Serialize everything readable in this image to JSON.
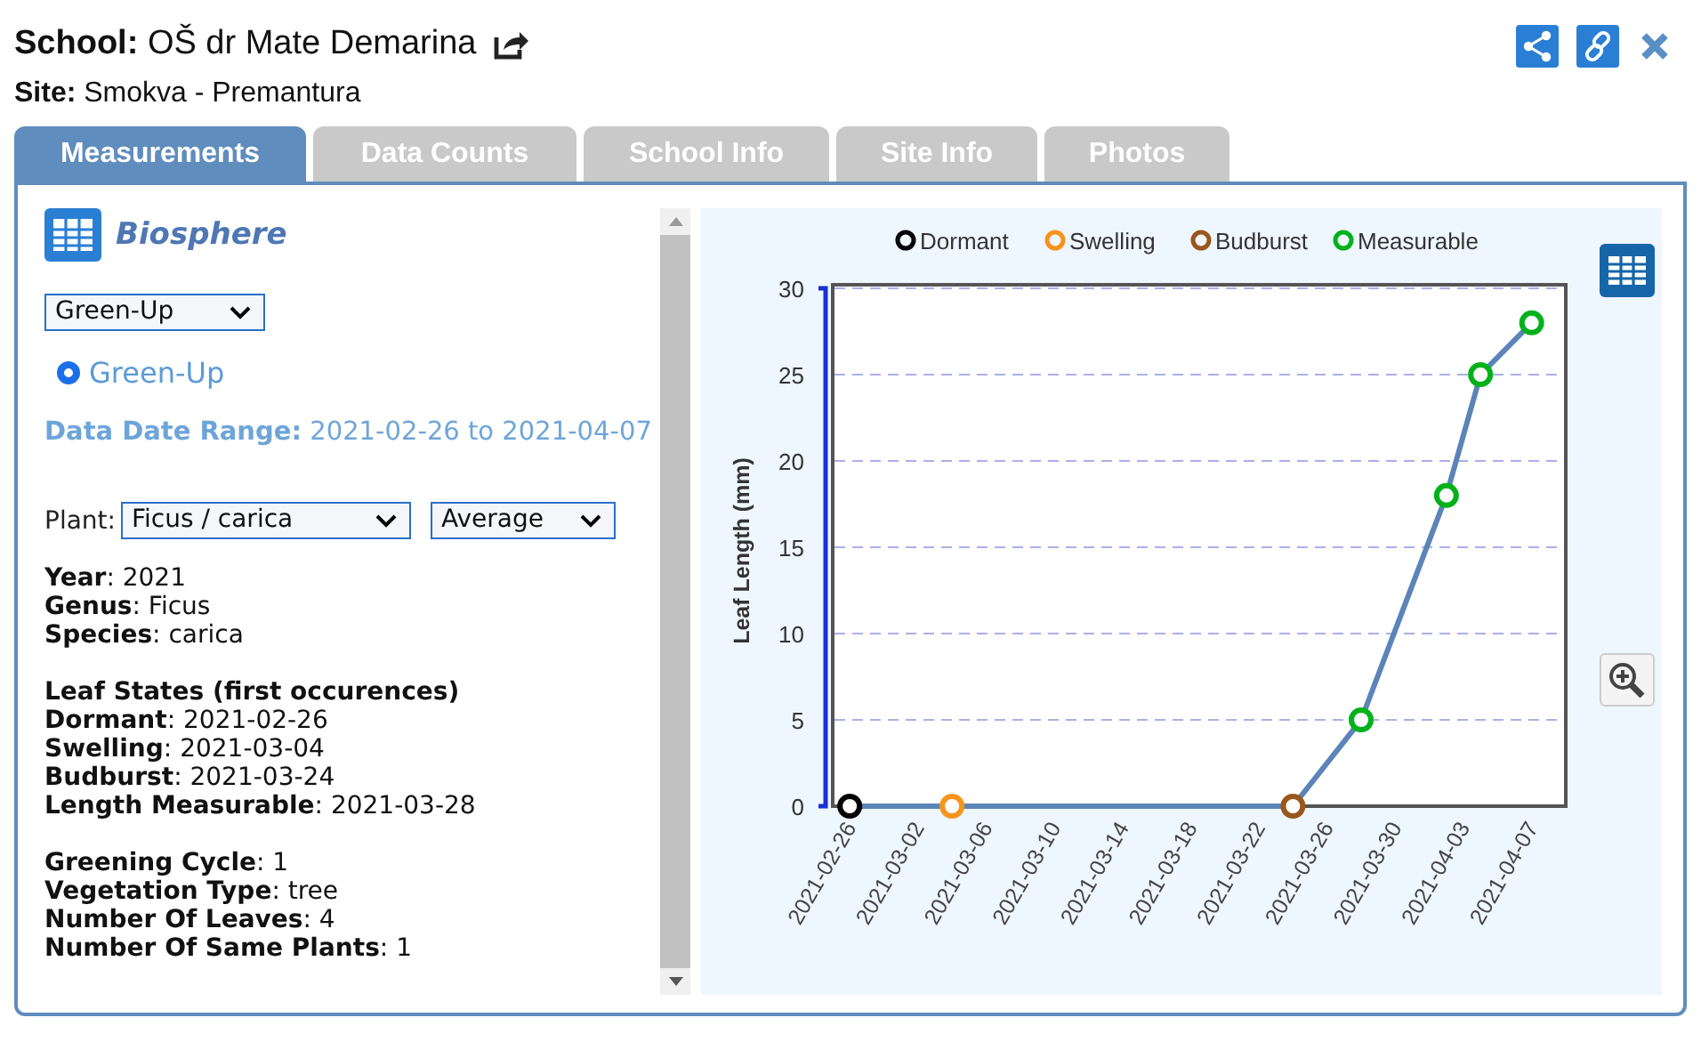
{
  "header": {
    "school_label": "School:",
    "school": "OŠ dr Mate Demarina",
    "site_label": "Site:",
    "site": "Smokva - Premantura"
  },
  "tabs": [
    {
      "label": "Measurements",
      "selected": true
    },
    {
      "label": "Data Counts",
      "selected": false
    },
    {
      "label": "School Info",
      "selected": false
    },
    {
      "label": "Site Info",
      "selected": false
    },
    {
      "label": "Photos",
      "selected": false
    }
  ],
  "protocol": {
    "title": "Biosphere",
    "dropdown": "Green-Up",
    "radio": {
      "label": "Green-Up",
      "selected": true
    },
    "date_range_label": "Data Date Range:",
    "date_range": "2021-02-26 to 2021-04-07"
  },
  "plant": {
    "label": "Plant:",
    "species_dropdown": "Ficus / carica",
    "mode_dropdown": "Average"
  },
  "info_groups": [
    {
      "lines": [
        "**Year**: 2021",
        "**Genus**: Ficus",
        "**Species**: carica"
      ]
    },
    {
      "heading": "Leaf States (first occurences)",
      "lines": [
        "**Dormant**: 2021-02-26",
        "**Swelling**: 2021-03-04",
        "**Budburst**: 2021-03-24",
        "**Length Measurable**: 2021-03-28"
      ]
    },
    {
      "lines": [
        "**Greening Cycle**: 1",
        "**Vegetation Type**: tree",
        "**Number Of Leaves**: 4",
        "**Number Of Same Plants**: 1"
      ]
    }
  ],
  "chart_data": {
    "type": "line",
    "ylabel": "Leaf Length (mm)",
    "x": [
      "2021-02-26",
      "2021-03-04",
      "2021-03-24",
      "2021-03-28",
      "2021-04-02",
      "2021-04-04",
      "2021-04-07"
    ],
    "xlim": [
      "2021-02-25",
      "2021-04-09"
    ],
    "ylim": [
      0,
      30
    ],
    "grid": "y",
    "legend": "top",
    "xticks": [
      "2021-02-26",
      "2021-03-02",
      "2021-03-06",
      "2021-03-10",
      "2021-03-14",
      "2021-03-18",
      "2021-03-22",
      "2021-03-26",
      "2021-03-30",
      "2021-04-03",
      "2021-04-07"
    ],
    "yticks": [
      0,
      5,
      10,
      15,
      20,
      25,
      30
    ],
    "series": [
      {
        "type": "line",
        "color": "#5b84b8",
        "values": [
          0,
          0,
          0,
          5,
          18,
          25,
          28
        ]
      },
      {
        "name": "Dormant",
        "type": "scatter",
        "color": "#000000",
        "values": [
          0,
          null,
          null,
          null,
          null,
          null,
          null
        ]
      },
      {
        "name": "Swelling",
        "type": "scatter",
        "color": "#f7941d",
        "values": [
          null,
          0,
          null,
          null,
          null,
          null,
          null
        ]
      },
      {
        "name": "Budburst",
        "type": "scatter",
        "color": "#99581b",
        "values": [
          null,
          null,
          0,
          null,
          null,
          null,
          null
        ]
      },
      {
        "name": "Measurable",
        "type": "scatter",
        "color": "#00b21a",
        "values": [
          null,
          null,
          null,
          5,
          18,
          25,
          28
        ]
      }
    ]
  }
}
